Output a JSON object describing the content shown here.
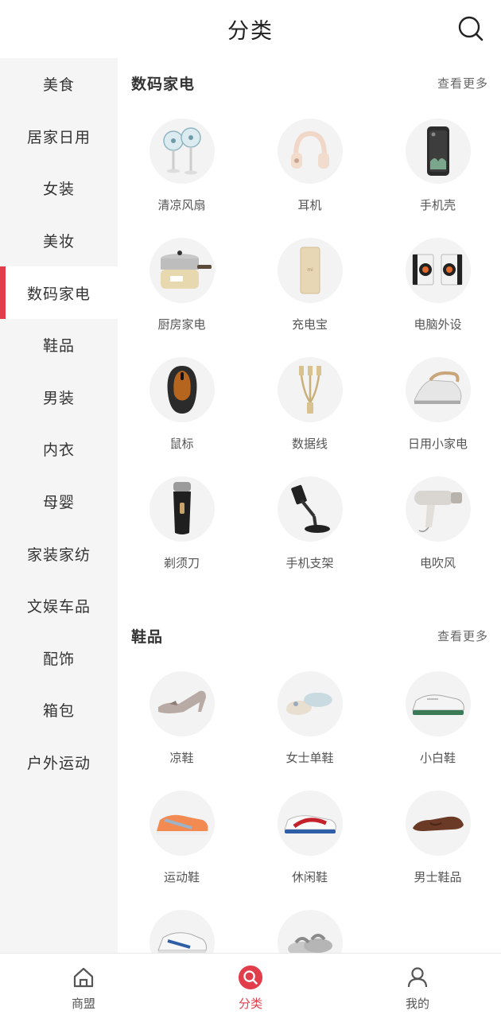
{
  "header": {
    "title": "分类",
    "search_icon": "search-icon"
  },
  "sidebar": {
    "active_index": 4,
    "items": [
      {
        "label": "美食"
      },
      {
        "label": "居家日用"
      },
      {
        "label": "女装"
      },
      {
        "label": "美妆"
      },
      {
        "label": "数码家电"
      },
      {
        "label": "鞋品"
      },
      {
        "label": "男装"
      },
      {
        "label": "内衣"
      },
      {
        "label": "母婴"
      },
      {
        "label": "家装家纺"
      },
      {
        "label": "文娱车品"
      },
      {
        "label": "配饰"
      },
      {
        "label": "箱包"
      },
      {
        "label": "户外运动"
      }
    ]
  },
  "sections": [
    {
      "title": "数码家电",
      "more": "查看更多",
      "items": [
        {
          "label": "清凉风扇",
          "icon": "fan-icon"
        },
        {
          "label": "耳机",
          "icon": "headphones-icon"
        },
        {
          "label": "手机壳",
          "icon": "phone-case-icon"
        },
        {
          "label": "厨房家电",
          "icon": "pot-icon"
        },
        {
          "label": "充电宝",
          "icon": "power-bank-icon"
        },
        {
          "label": "电脑外设",
          "icon": "speakers-icon"
        },
        {
          "label": "鼠标",
          "icon": "mouse-icon"
        },
        {
          "label": "数据线",
          "icon": "cable-icon"
        },
        {
          "label": "日用小家电",
          "icon": "iron-icon"
        },
        {
          "label": "剃须刀",
          "icon": "shaver-icon"
        },
        {
          "label": "手机支架",
          "icon": "phone-stand-icon"
        },
        {
          "label": "电吹风",
          "icon": "hair-dryer-icon"
        }
      ]
    },
    {
      "title": "鞋品",
      "more": "查看更多",
      "items": [
        {
          "label": "凉鞋",
          "icon": "heel-shoe-icon"
        },
        {
          "label": "女士单鞋",
          "icon": "flat-shoe-icon"
        },
        {
          "label": "小白鞋",
          "icon": "white-sneaker-icon"
        },
        {
          "label": "运动鞋",
          "icon": "running-shoe-icon"
        },
        {
          "label": "休闲鞋",
          "icon": "casual-shoe-icon"
        },
        {
          "label": "男士鞋品",
          "icon": "leather-shoe-icon"
        },
        {
          "label": "",
          "icon": "sneaker-icon"
        },
        {
          "label": "",
          "icon": "slipper-icon"
        }
      ]
    }
  ],
  "tabbar": {
    "active_index": 1,
    "tabs": [
      {
        "label": "商盟",
        "icon": "home-icon"
      },
      {
        "label": "分类",
        "icon": "category-search-icon"
      },
      {
        "label": "我的",
        "icon": "user-icon"
      }
    ]
  },
  "colors": {
    "accent": "#e23d4b",
    "sidebar_bg": "#f5f5f5",
    "thumb_bg": "#f3f3f3"
  }
}
